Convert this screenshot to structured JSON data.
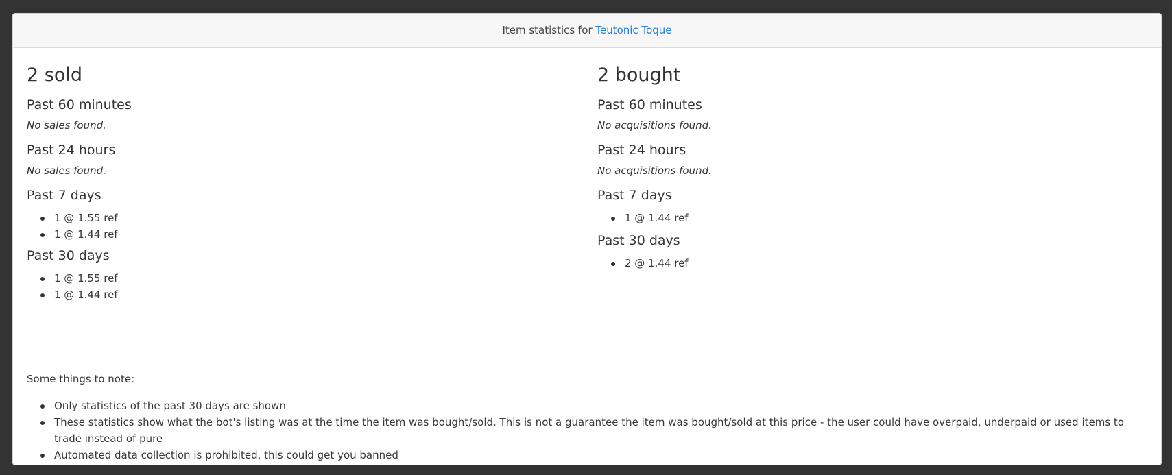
{
  "header": {
    "prefix": "Item statistics for",
    "item_link": "Teutonic Toque"
  },
  "sold": {
    "title": "2 sold",
    "periods": {
      "p60": {
        "label": "Past 60 minutes",
        "empty": "No sales found."
      },
      "p24": {
        "label": "Past 24 hours",
        "empty": "No sales found."
      },
      "p7": {
        "label": "Past 7 days",
        "items": [
          "1 @ 1.55 ref",
          "1 @ 1.44 ref"
        ]
      },
      "p30": {
        "label": "Past 30 days",
        "items": [
          "1 @ 1.55 ref",
          "1 @ 1.44 ref"
        ]
      }
    }
  },
  "bought": {
    "title": "2 bought",
    "periods": {
      "p60": {
        "label": "Past 60 minutes",
        "empty": "No acquisitions found."
      },
      "p24": {
        "label": "Past 24 hours",
        "empty": "No acquisitions found."
      },
      "p7": {
        "label": "Past 7 days",
        "items": [
          "1 @ 1.44 ref"
        ]
      },
      "p30": {
        "label": "Past 30 days",
        "items": [
          "2 @ 1.44 ref"
        ]
      }
    }
  },
  "notes": {
    "title": "Some things to note:",
    "items": [
      "Only statistics of the past 30 days are shown",
      "These statistics show what the bot's listing was at the time the item was bought/sold. This is not a guarantee the item was bought/sold at this price - the user could have overpaid, underpaid or used items to trade instead of pure",
      "Automated data collection is prohibited, this could get you banned"
    ]
  }
}
